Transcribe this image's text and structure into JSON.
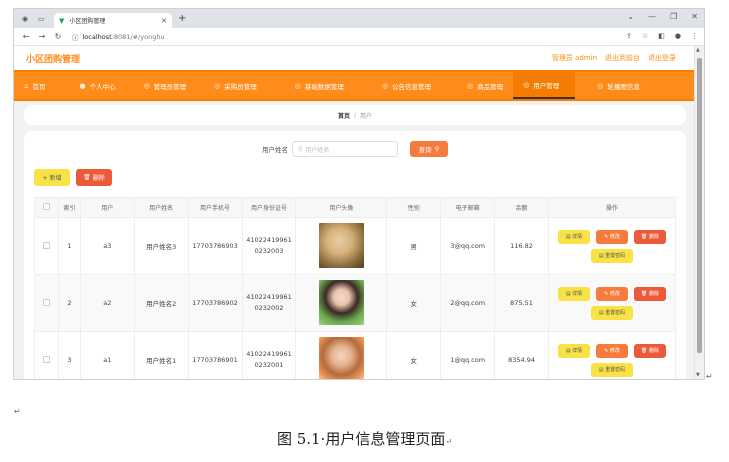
{
  "browser": {
    "tab_title": "小区团购管理",
    "url_domain": "localhost",
    "url_path": ":8081/#/yonghu"
  },
  "header": {
    "logo": "小区团购管理",
    "user_label": "管理员 admin",
    "back_label": "退出到前台",
    "logout_label": "退出登录"
  },
  "menu": [
    {
      "label": "首页",
      "icon": "home-icon"
    },
    {
      "label": "个人中心",
      "icon": "user-icon"
    },
    {
      "label": "管理员管理",
      "icon": "circle-icon"
    },
    {
      "label": "采购员管理",
      "icon": "circle-icon"
    },
    {
      "label": "基础数据管理",
      "icon": "circle-icon"
    },
    {
      "label": "公告信息管理",
      "icon": "circle-icon"
    },
    {
      "label": "商品管理",
      "icon": "circle-icon"
    },
    {
      "label": "用户管理",
      "icon": "circle-icon"
    },
    {
      "label": "轮播图信息",
      "icon": "circle-icon"
    }
  ],
  "breadcrumb": {
    "home": "首页",
    "sep": "/",
    "current": "用户"
  },
  "search": {
    "label": "用户姓名",
    "placeholder": "用户姓名",
    "button": "查询"
  },
  "actions": {
    "add": "+ 新增",
    "delete": "删除"
  },
  "table": {
    "headers": [
      "",
      "索引",
      "用户",
      "用户姓名",
      "用户手机号",
      "用户身份证号",
      "用户头像",
      "性别",
      "电子邮箱",
      "余额",
      "操作"
    ],
    "rows": [
      {
        "index": "1",
        "user": "a3",
        "name": "用户姓名3",
        "phone": "17703786903",
        "id1": "41022419961",
        "id2": "0232003",
        "gender": "男",
        "email": "3@qq.com",
        "balance": "116.82"
      },
      {
        "index": "2",
        "user": "a2",
        "name": "用户姓名2",
        "phone": "17703786902",
        "id1": "41022419961",
        "id2": "0232002",
        "gender": "女",
        "email": "2@qq.com",
        "balance": "875.51"
      },
      {
        "index": "3",
        "user": "a1",
        "name": "用户姓名1",
        "phone": "17703786901",
        "id1": "41022419961",
        "id2": "0232001",
        "gender": "女",
        "email": "1@qq.com",
        "balance": "8354.94"
      }
    ],
    "op_labels": {
      "detail": "详情",
      "edit": "修改",
      "remove": "删除",
      "reset": "重置密码"
    }
  },
  "caption": "图 5.1·用户信息管理页面",
  "colors": {
    "brand": "#ff8c1a",
    "danger": "#ec5a3c",
    "warning": "#f9e246"
  }
}
